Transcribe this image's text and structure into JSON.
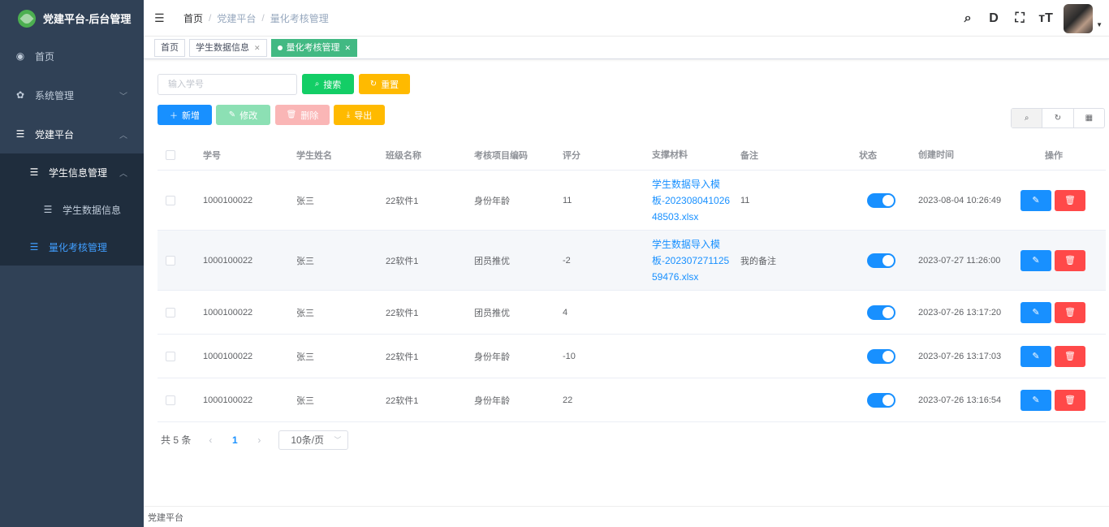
{
  "app": {
    "title": "党建平台-后台管理"
  },
  "sidebar": {
    "items": [
      {
        "label": "首页",
        "icon": "dashboard-icon"
      },
      {
        "label": "系统管理",
        "icon": "gear-icon"
      },
      {
        "label": "党建平台",
        "icon": "list-icon"
      }
    ],
    "sub": {
      "group_label": "学生信息管理",
      "items": [
        {
          "label": "学生数据信息"
        },
        {
          "label": "量化考核管理"
        }
      ]
    }
  },
  "breadcrumb": [
    "首页",
    "党建平台",
    "量化考核管理"
  ],
  "tags": [
    "首页",
    "学生数据信息",
    "量化考核管理"
  ],
  "search": {
    "placeholder": "输入学号",
    "search_label": "搜索",
    "reset_label": "重置"
  },
  "toolbar": {
    "add": "新增",
    "edit": "修改",
    "delete": "删除",
    "export": "导出"
  },
  "table": {
    "headers": {
      "student_id": "学号",
      "name": "学生姓名",
      "class": "班级名称",
      "code": "考核项目编码",
      "score": "评分",
      "material": "支撑材料",
      "note": "备注",
      "status": "状态",
      "created": "创建时间",
      "ops": "操作"
    },
    "rows": [
      {
        "student_id": "1000100022",
        "name": "张三",
        "class": "22软件1",
        "code": "身份年龄",
        "score": "11",
        "material": "学生数据导入模板-20230804102648503.xlsx",
        "note": "11",
        "created": "2023-08-04 10:26:49"
      },
      {
        "student_id": "1000100022",
        "name": "张三",
        "class": "22软件1",
        "code": "团员推优",
        "score": "-2",
        "material": "学生数据导入模板-20230727112559476.xlsx",
        "note": "我的备注",
        "created": "2023-07-27 11:26:00"
      },
      {
        "student_id": "1000100022",
        "name": "张三",
        "class": "22软件1",
        "code": "团员推优",
        "score": "4",
        "material": "",
        "note": "",
        "created": "2023-07-26 13:17:20"
      },
      {
        "student_id": "1000100022",
        "name": "张三",
        "class": "22软件1",
        "code": "身份年龄",
        "score": "-10",
        "material": "",
        "note": "",
        "created": "2023-07-26 13:17:03"
      },
      {
        "student_id": "1000100022",
        "name": "张三",
        "class": "22软件1",
        "code": "身份年龄",
        "score": "22",
        "material": "",
        "note": "",
        "created": "2023-07-26 13:16:54"
      }
    ]
  },
  "pagination": {
    "total": "共 5 条",
    "current": "1",
    "page_size": "10条/页"
  },
  "footer": {
    "text": "党建平台"
  },
  "colors": {
    "primary": "#1890ff",
    "success": "#13ce66",
    "warning": "#ffba00",
    "danger": "#ff4949",
    "sidebar": "#304156",
    "tag_active": "#42b983"
  }
}
